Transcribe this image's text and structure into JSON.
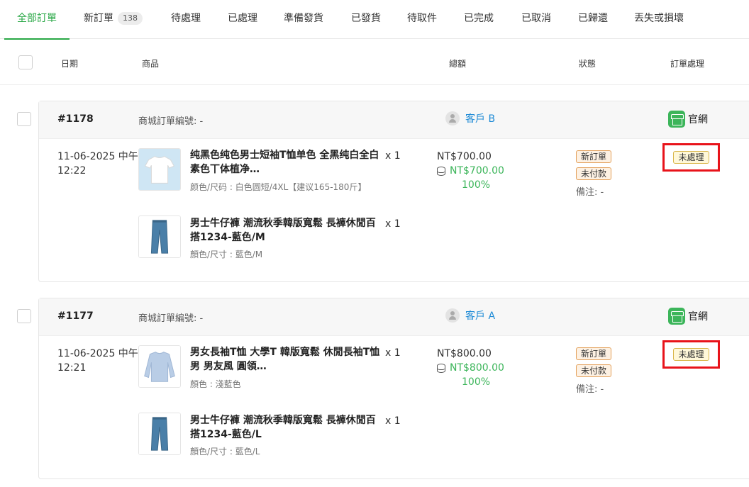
{
  "tabs": [
    {
      "label": "全部訂單",
      "active": true
    },
    {
      "label": "新訂單",
      "badge": "138"
    },
    {
      "label": "待處理"
    },
    {
      "label": "已處理"
    },
    {
      "label": "準備發貨"
    },
    {
      "label": "已發貨"
    },
    {
      "label": "待取件"
    },
    {
      "label": "已完成"
    },
    {
      "label": "已取消"
    },
    {
      "label": "已歸還"
    },
    {
      "label": "丟失或損壞"
    }
  ],
  "columns": {
    "date": "日期",
    "product": "商品",
    "total": "總額",
    "status": "狀態",
    "processing": "訂單處理"
  },
  "orders": [
    {
      "number": "#1178",
      "mall_order_no": "商城訂單編號: -",
      "customer": "客戶 B",
      "channel": "官網",
      "date": "11-06-2025 中午 12:22",
      "items": [
        {
          "name": "纯黑色纯色男士短袖T恤单色 全黑纯白全白素色丅体植净…",
          "variant": "颜色/尺码 : 白色圆短/4XL【建议165-180斤】",
          "qty": "x 1",
          "icon": "white-tshirt-image"
        },
        {
          "name": "男士牛仔褲 潮流秋季韓版寬鬆 長褲休閒百搭1234-藍色/M",
          "variant": "顏色/尺寸 : 藍色/M",
          "qty": "x 1",
          "icon": "jeans-image"
        }
      ],
      "total": "NT$700.00",
      "paid": "NT$700.00",
      "paid_pct": "100%",
      "tags": [
        "新訂單",
        "未付款"
      ],
      "note": "備注: -",
      "processing": "未處理"
    },
    {
      "number": "#1177",
      "mall_order_no": "商城訂單編號: -",
      "customer": "客戶 A",
      "channel": "官網",
      "date": "11-06-2025 中午 12:21",
      "items": [
        {
          "name": "男女長袖T恤 大學T 韓版寬鬆 休閒長袖T恤男 男友風 圓領…",
          "variant": "顏色 : 淺藍色",
          "qty": "x 1",
          "icon": "blue-sweatshirt-image"
        },
        {
          "name": "男士牛仔褲 潮流秋季韓版寬鬆 長褲休閒百搭1234-藍色/L",
          "variant": "顏色/尺寸 : 藍色/L",
          "qty": "x 1",
          "icon": "jeans-image"
        }
      ],
      "total": "NT$800.00",
      "paid": "NT$800.00",
      "paid_pct": "100%",
      "tags": [
        "新訂單",
        "未付款"
      ],
      "note": "備注: -",
      "processing": "未處理"
    }
  ]
}
